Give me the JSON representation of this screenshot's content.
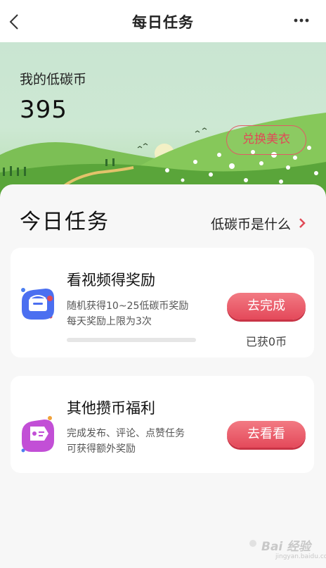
{
  "header": {
    "title": "每日任务"
  },
  "hero": {
    "balance_label": "我的低碳币",
    "balance_value": "395",
    "exchange_button": "兑换美衣"
  },
  "main": {
    "section_title": "今日任务",
    "info_link": "低碳币是什么"
  },
  "tasks": [
    {
      "title": "看视频得奖励",
      "desc_line1": "随机获得10~25低碳币奖励",
      "desc_line2": "每天奖励上限为3次",
      "button": "去完成",
      "earned": "已获0币",
      "progress": 0
    },
    {
      "title": "其他攒币福利",
      "desc_line1": "完成发布、评论、点赞任务",
      "desc_line2": "可获得额外奖励",
      "button": "去看看"
    }
  ],
  "watermark": {
    "text": "Bai 经验",
    "sub": "jingyan.baidu.com"
  },
  "colors": {
    "accent": "#e04a57",
    "hero_sky": "#c9e5d2",
    "hill_green": "#5aa53a"
  },
  "icons": [
    "chevron-left-icon",
    "more-icon",
    "chevron-right-icon",
    "video-wallet-icon",
    "coupon-tag-icon"
  ]
}
